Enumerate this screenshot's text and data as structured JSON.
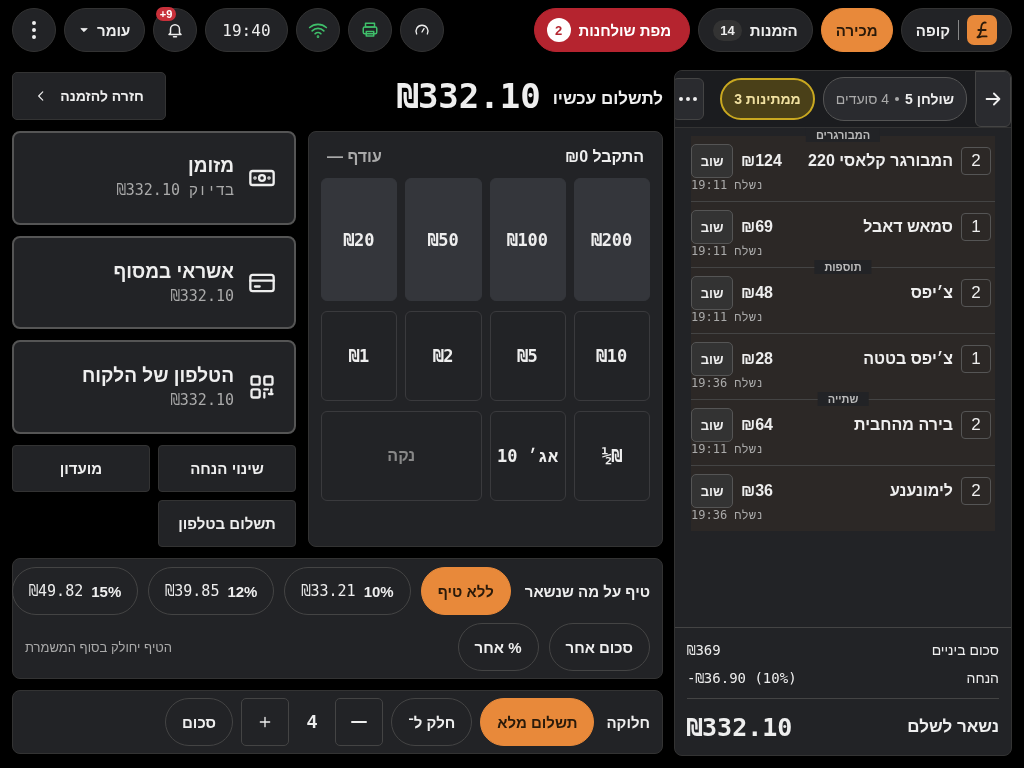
{
  "topbar": {
    "brand": "קופה",
    "tabs": [
      {
        "label": "מכירה",
        "selected": true
      },
      {
        "label": "הזמנות",
        "count": "14",
        "selected": false
      }
    ],
    "table_map": {
      "label": "מפת שולחנות",
      "count": "2"
    },
    "clock": "19:40",
    "notifications": "+9",
    "user": "עומר"
  },
  "order": {
    "table": "שולחן 5",
    "diners": "4 סועדים",
    "waiting": {
      "label": "ממתינות",
      "count": "3"
    },
    "groups": [
      {
        "title": "המבורגרים",
        "items": [
          {
            "qty": "2",
            "name": "המבורגר קלאסי 220",
            "price": "₪124",
            "action": "שוב",
            "sent": "נשלח 19:11"
          },
          {
            "qty": "1",
            "name": "סמאש דאבל",
            "price": "₪69",
            "action": "שוב",
            "sent": "נשלח 19:11"
          }
        ]
      },
      {
        "title": "תוספות",
        "items": [
          {
            "qty": "2",
            "name": "צ׳יפס",
            "price": "₪48",
            "action": "שוב",
            "sent": "נשלח 19:11"
          },
          {
            "qty": "1",
            "name": "צ׳יפס בטטה",
            "price": "₪28",
            "action": "שוב",
            "sent": "נשלח 19:36"
          }
        ]
      },
      {
        "title": "שתייה",
        "items": [
          {
            "qty": "2",
            "name": "בירה מהחבית",
            "price": "₪64",
            "action": "שוב",
            "sent": "נשלח 19:11"
          },
          {
            "qty": "2",
            "name": "לימונענע",
            "price": "₪36",
            "action": "שוב",
            "sent": "נשלח 19:36"
          }
        ]
      }
    ],
    "summary": [
      {
        "label": "סכום ביניים",
        "value": "₪369"
      },
      {
        "label": "הנחה",
        "value": "-₪36.90 (10%)"
      }
    ],
    "total": {
      "label": "נשאר לשלם",
      "value": "₪332.10"
    }
  },
  "payment": {
    "title": "לתשלום עכשיו",
    "amount": "₪332.10",
    "back": "חזרה להזמנה",
    "methods": [
      {
        "kind": "cash",
        "title": "מזומן",
        "sub": "בדיוק ₪332.10"
      },
      {
        "kind": "card",
        "title": "אשראי במסוף",
        "sub": "₪332.10"
      },
      {
        "kind": "qr",
        "title": "הטלפון של הלקוח",
        "sub": "₪332.10"
      }
    ],
    "extra_buttons": [
      "שינוי הנחה",
      "מועדון",
      "תשלום בטלפון"
    ],
    "cash": {
      "received": "התקבל ₪0",
      "change": "עודף —",
      "keys": [
        {
          "kind": "bill",
          "label": "₪200"
        },
        {
          "kind": "bill",
          "label": "₪100"
        },
        {
          "kind": "bill",
          "label": "₪50"
        },
        {
          "kind": "bill",
          "label": "₪20"
        },
        {
          "kind": "coin",
          "label": "₪10"
        },
        {
          "kind": "coin",
          "label": "₪5"
        },
        {
          "kind": "coin",
          "label": "₪2"
        },
        {
          "kind": "coin",
          "label": "₪1"
        },
        {
          "kind": "coin",
          "label": "₪½"
        },
        {
          "kind": "coin",
          "label": "אג׳ 10"
        },
        {
          "kind": "clear",
          "label": "נקה"
        }
      ]
    }
  },
  "tip": {
    "label": "טיף על מה שנשאר",
    "options": [
      {
        "label": "ללא טיף",
        "selected": true
      },
      {
        "percent": "10%",
        "amount": "₪33.21",
        "selected": false
      },
      {
        "percent": "12%",
        "amount": "₪39.85",
        "selected": false
      },
      {
        "percent": "15%",
        "amount": "₪49.82",
        "selected": false
      }
    ],
    "other": [
      "סכום אחר",
      "% אחר"
    ],
    "note": "הטיף יחולק בסוף המשמרת"
  },
  "split": {
    "label": "חלוקה",
    "options": [
      {
        "label": "תשלום מלא",
        "selected": true
      },
      {
        "label": "חלק ל־",
        "selected": false
      }
    ],
    "count": "4",
    "amount": {
      "label": "סכום",
      "selected": false
    }
  }
}
